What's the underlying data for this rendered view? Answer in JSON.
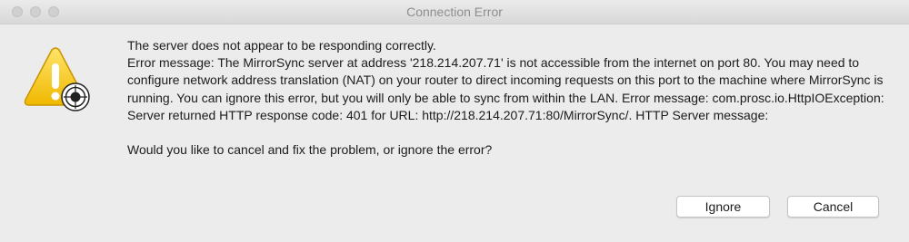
{
  "window": {
    "title": "Connection Error"
  },
  "icon": "warning-triangle-icon",
  "message": {
    "headline": "The server does not appear to be responding correctly.",
    "detail": "Error message: The MirrorSync server at address '218.214.207.71' is not accessible from the internet on port 80. You may need to configure network address translation (NAT) on your router to direct incoming requests on this port to the machine where MirrorSync is running. You can ignore this error, but you will only be able to sync from within the LAN. Error message: com.prosc.io.HttpIOException: Server returned HTTP response code: 401 for URL: http://218.214.207.71:80/MirrorSync/. HTTP Server message:",
    "question": "Would you like to cancel and fix the problem, or ignore the error?"
  },
  "buttons": {
    "ignore_label": "Ignore",
    "cancel_label": "Cancel"
  },
  "colors": {
    "background": "#ececec",
    "warning_yellow": "#f5c400",
    "text": "#1c1c1c"
  }
}
